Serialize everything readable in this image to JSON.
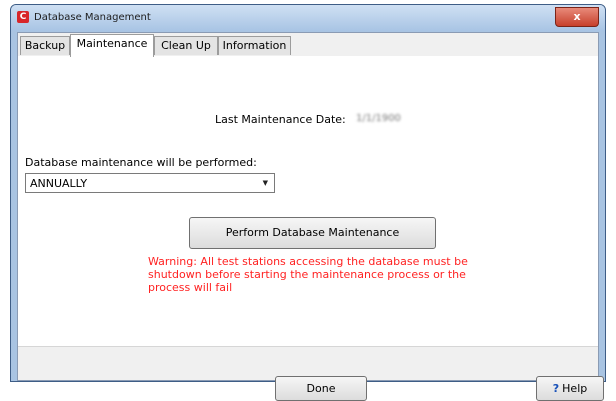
{
  "window": {
    "title": "Database Management",
    "app_icon_letter": "C",
    "close_glyph": "x"
  },
  "tabs": [
    {
      "label": "Backup",
      "active": false
    },
    {
      "label": "Maintenance",
      "active": true
    },
    {
      "label": "Clean Up",
      "active": false
    },
    {
      "label": "Information",
      "active": false
    }
  ],
  "maintenance": {
    "last_date_label": "Last Maintenance Date:",
    "last_date_value": "1/1/1900",
    "schedule_label": "Database maintenance will be performed:",
    "schedule_value": "ANNUALLY",
    "perform_button_label": "Perform Database Maintenance",
    "warning_text": "Warning: All test stations accessing the database must be shutdown before starting the maintenance process or the process will fail"
  },
  "footer": {
    "done_label": "Done",
    "help_label": "Help",
    "help_icon": "?"
  },
  "colors": {
    "warning": "#ff2222",
    "titlebar": "#a8c4e4",
    "close_button": "#c7402c"
  },
  "icons": [
    "app-icon",
    "close-icon",
    "dropdown-arrow-icon",
    "help-icon"
  ]
}
